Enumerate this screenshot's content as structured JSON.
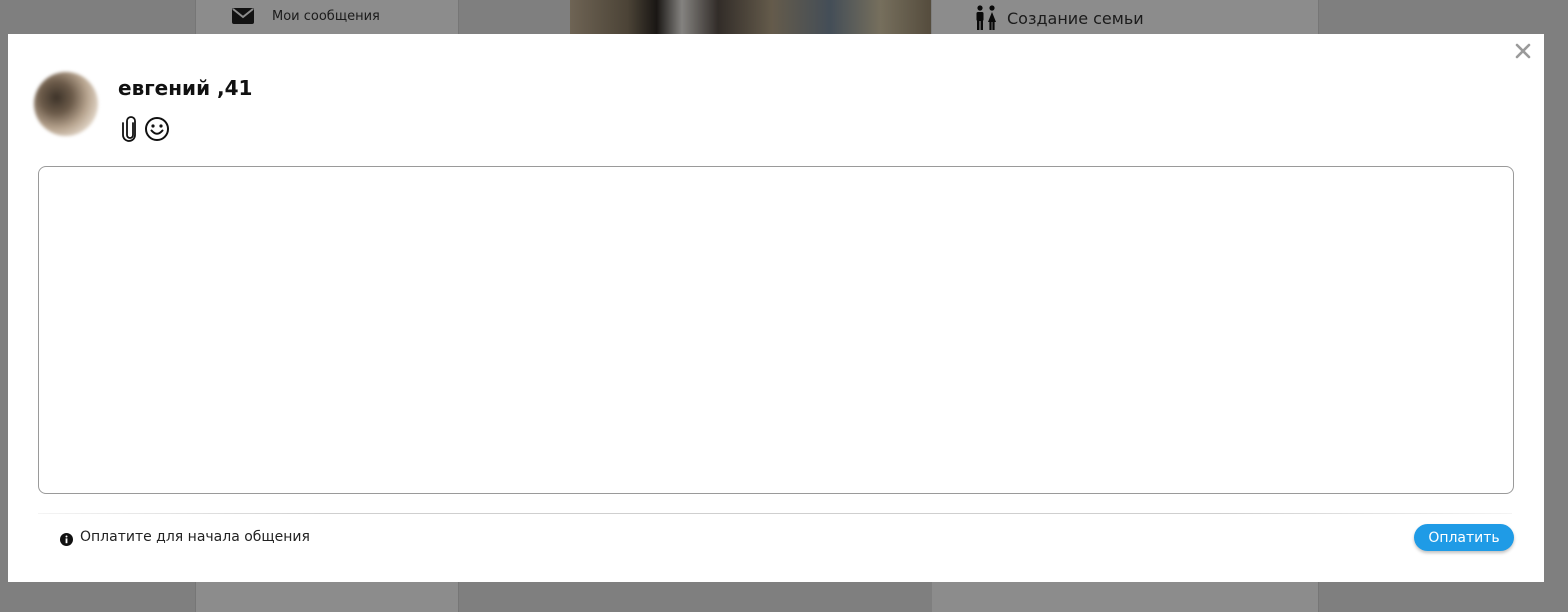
{
  "background": {
    "menu_item_label": "Мои сообщения",
    "menu_item_icon": "envelope-icon",
    "family_label": "Создание семьи",
    "family_icon": "couple-icon"
  },
  "modal": {
    "close_icon": "close-icon",
    "user_name": "евгений ,41",
    "tools": [
      "paperclip-icon",
      "smiley-icon"
    ],
    "message_value": "",
    "notice_icon": "info-icon",
    "notice_text": "Оплатите для начала общения",
    "pay_button_label": "Оплатить"
  },
  "colors": {
    "accent": "#1f9be6",
    "overlay": "#8c8c8c"
  }
}
